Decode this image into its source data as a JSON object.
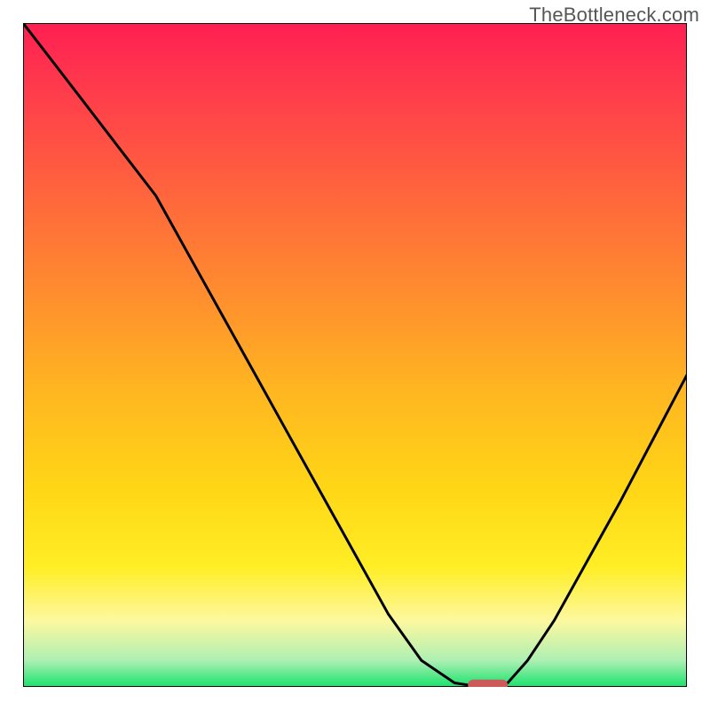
{
  "watermark": "TheBottleneck.com",
  "chart_data": {
    "type": "line",
    "title": "",
    "xlabel": "",
    "ylabel": "",
    "xlim": [
      0,
      100
    ],
    "ylim": [
      0,
      100
    ],
    "grid": false,
    "series": [
      {
        "name": "curve",
        "x": [
          0,
          5,
          10,
          15,
          20,
          25,
          30,
          35,
          40,
          45,
          50,
          55,
          60,
          65,
          67,
          70,
          73,
          76,
          80,
          85,
          90,
          95,
          100
        ],
        "y": [
          100,
          93.5,
          87,
          80.5,
          74,
          65,
          56,
          47,
          38,
          29,
          20,
          11,
          4,
          0.6,
          0.3,
          0.3,
          0.6,
          4,
          10,
          19,
          28,
          37.5,
          47
        ]
      }
    ],
    "marker": {
      "name": "target-marker",
      "x_range": [
        67,
        73
      ],
      "y": 0.3,
      "color": "#cc5a5a"
    },
    "background_gradient": {
      "stops": [
        {
          "offset": 0.0,
          "color": "#ff1f52"
        },
        {
          "offset": 0.1,
          "color": "#ff3b4c"
        },
        {
          "offset": 0.25,
          "color": "#ff633d"
        },
        {
          "offset": 0.4,
          "color": "#ff8b2f"
        },
        {
          "offset": 0.55,
          "color": "#ffb521"
        },
        {
          "offset": 0.7,
          "color": "#ffd616"
        },
        {
          "offset": 0.82,
          "color": "#ffee26"
        },
        {
          "offset": 0.9,
          "color": "#fdf89f"
        },
        {
          "offset": 0.96,
          "color": "#aef0b3"
        },
        {
          "offset": 1.0,
          "color": "#19e26c"
        }
      ]
    }
  }
}
